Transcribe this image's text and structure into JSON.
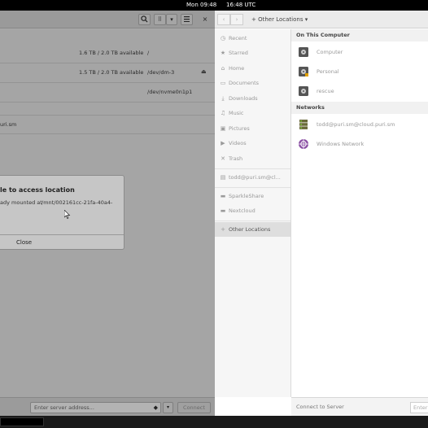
{
  "topbar": {
    "clock": "Mon 09:48",
    "clock_extra": "16:48 UTC"
  },
  "left_window": {
    "header": {
      "search_icon": "search-icon",
      "view_toggle": "⠿",
      "dropdown": "▾",
      "close": "×"
    },
    "rows": [
      {
        "size": "1.6 TB / 2.0 TB available",
        "path": "/"
      },
      {
        "size": "1.5 TB / 2.0 TB available",
        "path": "/dev/dm-3"
      },
      {
        "size": "",
        "path": "/dev/nvme0n1p1"
      }
    ],
    "network_row": "uri.sm",
    "footer": {
      "placeholder": "Enter server address...",
      "connect": "Connect"
    }
  },
  "dialog": {
    "title": "le to access location",
    "text": "ady mounted at",
    "path": "/mnt/002161cc-21fa-40a4-",
    "close": "Close"
  },
  "right_window": {
    "header": {
      "back": "‹",
      "forward": "›",
      "location": "Other Locations",
      "location_caret": "▾"
    },
    "sidebar": [
      {
        "icon": "clock-icon",
        "glyph": "◷",
        "label": "Recent"
      },
      {
        "icon": "star-icon",
        "glyph": "★",
        "label": "Starred"
      },
      {
        "icon": "home-icon",
        "glyph": "⌂",
        "label": "Home"
      },
      {
        "icon": "documents-icon",
        "glyph": "▭",
        "label": "Documents"
      },
      {
        "icon": "downloads-icon",
        "glyph": "⤓",
        "label": "Downloads"
      },
      {
        "icon": "music-icon",
        "glyph": "♫",
        "label": "Music"
      },
      {
        "icon": "pictures-icon",
        "glyph": "▣",
        "label": "Pictures"
      },
      {
        "icon": "videos-icon",
        "glyph": "▶",
        "label": "Videos"
      },
      {
        "icon": "trash-icon",
        "glyph": "🗑",
        "label": "Trash"
      },
      {
        "icon": "network-drive-icon",
        "glyph": "▤",
        "label": "todd@puri.sm@cl..."
      },
      {
        "icon": "folder-icon",
        "glyph": "▬",
        "label": "SparkleShare"
      },
      {
        "icon": "folder-icon",
        "glyph": "▬",
        "label": "Nextcloud"
      },
      {
        "icon": "plus-icon",
        "glyph": "+",
        "label": "Other Locations"
      }
    ],
    "sections": {
      "on_this_computer": "On This Computer",
      "networks": "Networks"
    },
    "computer_items": [
      {
        "icon": "drive-icon",
        "label": "Computer"
      },
      {
        "icon": "drive-icon",
        "label": "Personal"
      },
      {
        "icon": "drive-icon",
        "label": "rescue"
      }
    ],
    "network_items": [
      {
        "icon": "network-server-icon",
        "label": "todd@puri.sm@cloud.puri.sm"
      },
      {
        "icon": "windows-network-icon",
        "label": "Windows Network"
      }
    ],
    "footer": {
      "label": "Connect to Server",
      "placeholder": "Enter"
    }
  }
}
